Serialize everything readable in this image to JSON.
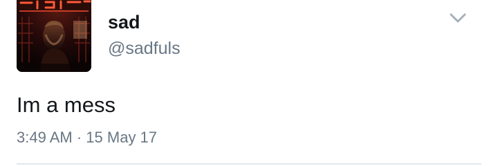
{
  "tweet": {
    "display_name": "sad",
    "handle": "@sadfuls",
    "text": "Im a mess",
    "time": "3:49 AM",
    "separator": "·",
    "date": "15 May 17"
  },
  "icons": {
    "menu": "chevron-down-icon",
    "avatar": "profile-photo"
  },
  "colors": {
    "text_primary": "#14171a",
    "text_secondary": "#687784",
    "chevron": "#a3b1bc",
    "divider": "#e3e8ec",
    "avatar_neon": "#e0402c"
  }
}
